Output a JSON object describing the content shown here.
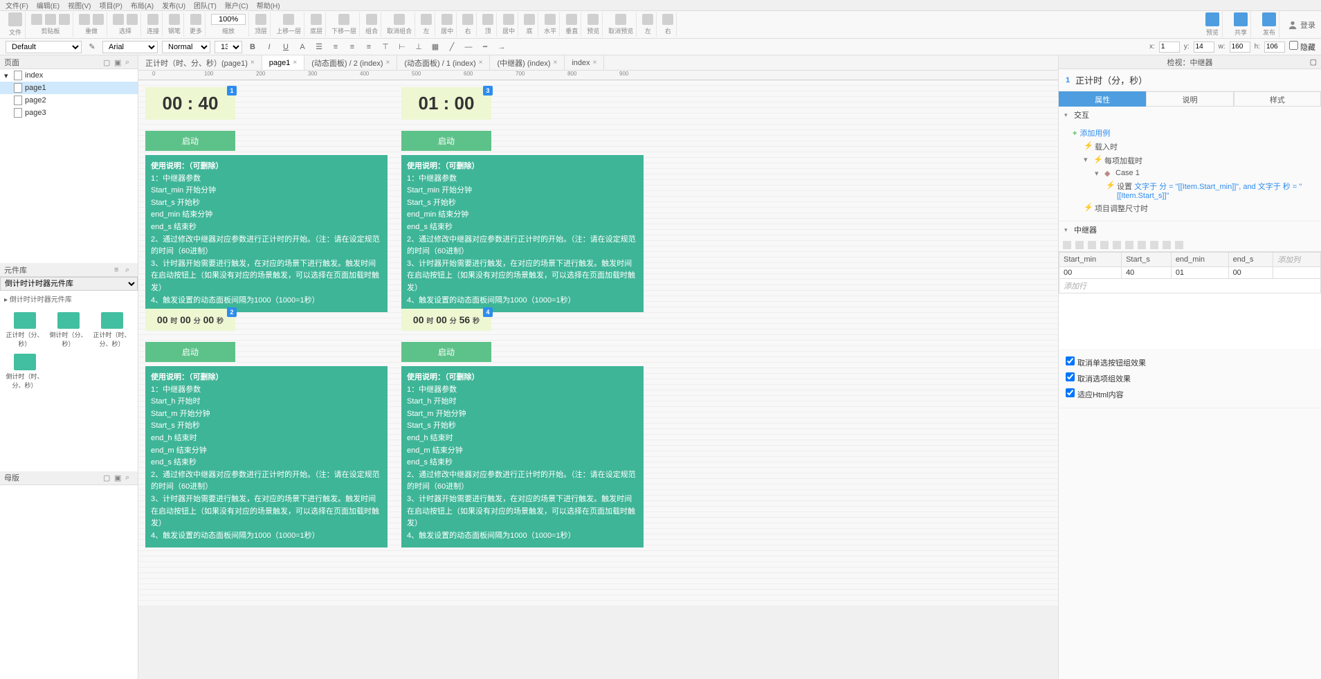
{
  "menubar": [
    "文件(F)",
    "编辑(E)",
    "视图(V)",
    "项目(P)",
    "布局(A)",
    "发布(U)",
    "团队(T)",
    "账户(C)",
    "帮助(H)"
  ],
  "ribbon": {
    "groups": [
      {
        "label": "文件"
      },
      {
        "label": "剪贴板"
      },
      {
        "label": "重做"
      },
      {
        "label": "选择",
        "items": 2
      },
      {
        "label": "连接"
      },
      {
        "label": "钢笔"
      },
      {
        "label": "更多"
      },
      {
        "zoom": "100%",
        "label": "缩放"
      },
      {
        "label": "顶层"
      },
      {
        "label": "上移一层"
      },
      {
        "label": "底层"
      },
      {
        "label": "下移一层"
      },
      {
        "label": "组合"
      },
      {
        "label": "取消组合"
      },
      {
        "label": "左"
      },
      {
        "label": "居中"
      },
      {
        "label": "右"
      },
      {
        "label": "顶"
      },
      {
        "label": "居中"
      },
      {
        "label": "底"
      },
      {
        "label": "水平"
      },
      {
        "label": "垂直"
      },
      {
        "label": "预览"
      },
      {
        "label": "取消预览"
      },
      {
        "label": "左"
      },
      {
        "label": "右"
      }
    ],
    "right": [
      {
        "label": "预览"
      },
      {
        "label": "共享"
      },
      {
        "label": "发布"
      }
    ],
    "login": "登录"
  },
  "format": {
    "style_default": "Default",
    "font": "Arial",
    "weight": "Normal",
    "size": "13",
    "coords": {
      "x_label": "x:",
      "x": "1",
      "y_label": "y:",
      "y": "14",
      "w_label": "w:",
      "w": "160",
      "h_label": "h:",
      "h": "106"
    },
    "hide": "隐藏"
  },
  "pagesPanel": {
    "title": "页面",
    "root": "index",
    "pages": [
      "page1",
      "page2",
      "page3"
    ],
    "selected": "page1"
  },
  "libPanel": {
    "title": "元件库",
    "selected": "倒计时计时器元件库",
    "category": "倒计时计时器元件库",
    "items": [
      "正计时（分、秒）",
      "倒计时（分、秒）",
      "正计时（时、分、秒）",
      "倒计时（时、分、秒）"
    ]
  },
  "mastersPanel": {
    "title": "母版"
  },
  "tabs": [
    {
      "label": "正计时（时、分、秒）(page1)"
    },
    {
      "label": "page1",
      "active": true
    },
    {
      "label": "(动态面板) / 2 (index)"
    },
    {
      "label": "(动态面板) / 1 (index)"
    },
    {
      "label": "(中继器) (index)"
    },
    {
      "label": "index"
    }
  ],
  "rulerMarks": [
    "0",
    "100",
    "200",
    "300",
    "400",
    "500",
    "600",
    "700",
    "800",
    "900"
  ],
  "widgets": {
    "w1": {
      "badge": "1",
      "time": "00 : 40",
      "btn": "启动"
    },
    "w3": {
      "badge": "3",
      "time": "01 : 00",
      "btn": "启动"
    },
    "w2": {
      "badge": "2",
      "h": "00",
      "m": "00",
      "s": "00",
      "unit_h": "时",
      "unit_m": "分",
      "unit_s": "秒",
      "btn": "启动"
    },
    "w4": {
      "badge": "4",
      "h": "00",
      "m": "00",
      "s": "56",
      "unit_h": "时",
      "unit_m": "分",
      "unit_s": "秒",
      "btn": "启动"
    },
    "instr_ms": {
      "title": "使用说明：（可删除）",
      "l1": "1：中继器参数",
      "l2": "Start_min    开始分钟",
      "l3": "Start_s        开始秒",
      "l4": "end_min     结束分钟",
      "l5": "end_s          结束秒",
      "l6": "2、通过修改中继器对应参数进行正计时的开始。（注：请在设定规范的时间（60进制）",
      "l7": "3、计时器开始需要进行触发，在对应的场景下进行触发。触发时间在启动按钮上（如果没有对应的场景触发，可以选择在页面加载时触发）",
      "l8": "4、触发设置的动态面板间隔为1000（1000=1秒）"
    },
    "instr_hms": {
      "title": "使用说明：（可删除）",
      "l1": "1：中继器参数",
      "l2": "Start_h      开始时",
      "l3": "Start_m     开始分钟",
      "l4": "Start_s      开始秒",
      "l5": "end_h        结束时",
      "l6": "end_m       结束分钟",
      "l7": "end_s         结束秒",
      "l8": "2、通过修改中继器对应参数进行正计时的开始。（注：请在设定规范的时间（60进制）",
      "l9": "3、计时器开始需要进行触发，在对应的场景下进行触发。触发时间在启动按钮上（如果没有对应的场景触发，可以选择在页面加载时触发）",
      "l10": "4、触发设置的动态面板间隔为1000（1000=1秒）"
    }
  },
  "inspector": {
    "panelTitle": "检视：中继器",
    "num": "1",
    "name": "正计时（分，秒）",
    "tabs": [
      "属性",
      "说明",
      "样式"
    ],
    "interactions": {
      "title": "交互",
      "addCase": "添加用例",
      "events": {
        "onLoad": "载入时",
        "onItemLoad": "每项加载时",
        "case1": "Case 1",
        "action_pre": "设置 ",
        "action_link": "文字于 分 = \"[[Item.Start_min]]\", and 文字于 秒 = \"[[Item.Start_s]]\"",
        "onResize": "项目调整尺寸时"
      }
    },
    "repeater": {
      "title": "中继器",
      "cols": [
        "Start_min",
        "Start_s",
        "end_min",
        "end_s"
      ],
      "addCol": "添加列",
      "addRow": "添加行",
      "rows": [
        [
          "00",
          "40",
          "01",
          "00"
        ]
      ]
    },
    "options": {
      "opt1": "取消单选按钮组效果",
      "opt2": "取消选项组效果",
      "opt3": "适应Html内容"
    }
  }
}
